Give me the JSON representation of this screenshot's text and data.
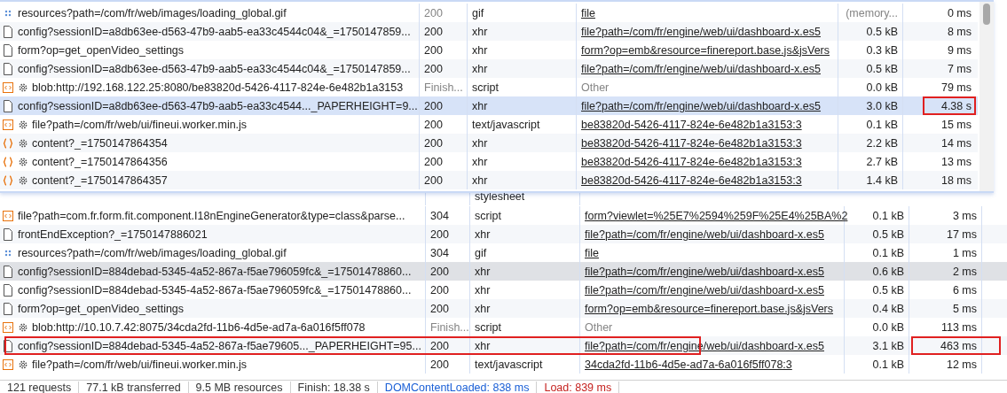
{
  "overlay_table": {
    "rows": [
      {
        "kind": "image",
        "worker": false,
        "name": "resources?path=/com/fr/web/images/loading_global.gif",
        "status": "200",
        "status_dim": true,
        "type": "gif",
        "initiator": "file",
        "initiator_link": true,
        "size": "(memory...",
        "size_dim": true,
        "time": "0 ms",
        "selected": false,
        "highlight_time": false
      },
      {
        "kind": "doc",
        "worker": false,
        "name": "config?sessionID=a8db63ee-d563-47b9-aab5-ea33c4544c04&_=1750147859...",
        "status": "200",
        "status_dim": false,
        "type": "xhr",
        "initiator": "file?path=/com/fr/engine/web/ui/dashboard-x.es5",
        "initiator_link": true,
        "size": "0.5 kB",
        "size_dim": false,
        "time": "8 ms",
        "selected": false,
        "highlight_time": false
      },
      {
        "kind": "doc",
        "worker": false,
        "name": "form?op=get_openVideo_settings",
        "status": "200",
        "status_dim": false,
        "type": "xhr",
        "initiator": "form?op=emb&resource=finereport.base.js&jsVers",
        "initiator_link": true,
        "size": "0.3 kB",
        "size_dim": false,
        "time": "9 ms",
        "selected": false,
        "highlight_time": false
      },
      {
        "kind": "doc",
        "worker": false,
        "name": "config?sessionID=a8db63ee-d563-47b9-aab5-ea33c4544c04&_=1750147859...",
        "status": "200",
        "status_dim": false,
        "type": "xhr",
        "initiator": "file?path=/com/fr/engine/web/ui/dashboard-x.es5",
        "initiator_link": true,
        "size": "0.5 kB",
        "size_dim": false,
        "time": "7 ms",
        "selected": false,
        "highlight_time": false
      },
      {
        "kind": "script",
        "worker": true,
        "name": "blob:http://192.168.122.25:8080/be83820d-5426-4117-824e-6e482b1a3153",
        "status": "Finish...",
        "status_dim": true,
        "type": "script",
        "initiator": "Other",
        "initiator_link": false,
        "size": "0.0 kB",
        "size_dim": false,
        "time": "79 ms",
        "selected": false,
        "highlight_time": false
      },
      {
        "kind": "doc",
        "worker": false,
        "name": "config?sessionID=a8db63ee-d563-47b9-aab5-ea33c4544..._PAPERHEIGHT=9...",
        "status": "200",
        "status_dim": false,
        "type": "xhr",
        "initiator": "file?path=/com/fr/engine/web/ui/dashboard-x.es5",
        "initiator_link": true,
        "size": "3.0 kB",
        "size_dim": false,
        "time": "4.38 s",
        "selected": true,
        "highlight_time": true
      },
      {
        "kind": "script",
        "worker": true,
        "name": "file?path=/com/fr/web/ui/fineui.worker.min.js",
        "status": "200",
        "status_dim": false,
        "type": "text/javascript",
        "initiator": "be83820d-5426-4117-824e-6e482b1a3153:3",
        "initiator_link": true,
        "size": "0.1 kB",
        "size_dim": false,
        "time": "15 ms",
        "selected": false,
        "highlight_time": false
      },
      {
        "kind": "fetch",
        "worker": true,
        "name": "content?_=1750147864354",
        "status": "200",
        "status_dim": false,
        "type": "xhr",
        "initiator": "be83820d-5426-4117-824e-6e482b1a3153:3",
        "initiator_link": true,
        "size": "2.2 kB",
        "size_dim": false,
        "time": "14 ms",
        "selected": false,
        "highlight_time": false
      },
      {
        "kind": "fetch",
        "worker": true,
        "name": "content?_=1750147864356",
        "status": "200",
        "status_dim": false,
        "type": "xhr",
        "initiator": "be83820d-5426-4117-824e-6e482b1a3153:3",
        "initiator_link": true,
        "size": "2.7 kB",
        "size_dim": false,
        "time": "13 ms",
        "selected": false,
        "highlight_time": false
      },
      {
        "kind": "fetch",
        "worker": true,
        "name": "content?_=1750147864357",
        "status": "200",
        "status_dim": false,
        "type": "xhr",
        "initiator": "be83820d-5426-4117-824e-6e482b1a3153:3",
        "initiator_link": true,
        "size": "1.4 kB",
        "size_dim": false,
        "time": "18 ms",
        "selected": false,
        "highlight_time": false
      }
    ]
  },
  "table": {
    "covered_row_type": "stylesheet",
    "rows": [
      {
        "kind": "script",
        "worker": false,
        "name": "file?path=com.fr.form.fit.component.I18nEngineGenerator&type=class&parse...",
        "status": "304",
        "status_dim": false,
        "type": "script",
        "initiator": "form?viewlet=%25E7%2594%259F%25E4%25BA%2",
        "initiator_link": true,
        "size": "0.1 kB",
        "time": "3 ms",
        "hovered": false,
        "highlight_name": false,
        "highlight_time": false
      },
      {
        "kind": "doc",
        "worker": false,
        "name": "frontEndException?_=1750147886021",
        "status": "200",
        "status_dim": false,
        "type": "xhr",
        "initiator": "file?path=/com/fr/engine/web/ui/dashboard-x.es5",
        "initiator_link": true,
        "size": "0.5 kB",
        "time": "17 ms",
        "hovered": false,
        "highlight_name": false,
        "highlight_time": false
      },
      {
        "kind": "image",
        "worker": false,
        "name": "resources?path=/com/fr/web/images/loading_global.gif",
        "status": "304",
        "status_dim": false,
        "type": "gif",
        "initiator": "file",
        "initiator_link": true,
        "size": "0.1 kB",
        "time": "1 ms",
        "hovered": false,
        "highlight_name": false,
        "highlight_time": false
      },
      {
        "kind": "doc",
        "worker": false,
        "name": "config?sessionID=884debad-5345-4a52-867a-f5ae796059fc&_=17501478860...",
        "status": "200",
        "status_dim": false,
        "type": "xhr",
        "initiator": "file?path=/com/fr/engine/web/ui/dashboard-x.es5",
        "initiator_link": true,
        "size": "0.6 kB",
        "time": "2 ms",
        "hovered": true,
        "highlight_name": false,
        "highlight_time": false
      },
      {
        "kind": "doc",
        "worker": false,
        "name": "config?sessionID=884debad-5345-4a52-867a-f5ae796059fc&_=17501478860...",
        "status": "200",
        "status_dim": false,
        "type": "xhr",
        "initiator": "file?path=/com/fr/engine/web/ui/dashboard-x.es5",
        "initiator_link": true,
        "size": "0.5 kB",
        "time": "6 ms",
        "hovered": false,
        "highlight_name": false,
        "highlight_time": false
      },
      {
        "kind": "doc",
        "worker": false,
        "name": "form?op=get_openVideo_settings",
        "status": "200",
        "status_dim": false,
        "type": "xhr",
        "initiator": "form?op=emb&resource=finereport.base.js&jsVers",
        "initiator_link": true,
        "size": "0.4 kB",
        "time": "5 ms",
        "hovered": false,
        "highlight_name": false,
        "highlight_time": false
      },
      {
        "kind": "script",
        "worker": true,
        "name": "blob:http://10.10.7.42:8075/34cda2fd-11b6-4d5e-ad7a-6a016f5ff078",
        "status": "Finish...",
        "status_dim": true,
        "type": "script",
        "initiator": "Other",
        "initiator_link": false,
        "size": "0.0 kB",
        "time": "113 ms",
        "hovered": false,
        "highlight_name": false,
        "highlight_time": false
      },
      {
        "kind": "doc",
        "worker": false,
        "name": "config?sessionID=884debad-5345-4a52-867a-f5ae79605..._PAPERHEIGHT=95...",
        "status": "200",
        "status_dim": false,
        "type": "xhr",
        "initiator": "file?path=/com/fr/engine/web/ui/dashboard-x.es5",
        "initiator_link": true,
        "size": "3.1 kB",
        "time": "463 ms",
        "hovered": false,
        "highlight_name": true,
        "highlight_time": true
      },
      {
        "kind": "script",
        "worker": true,
        "name": "file?path=/com/fr/web/ui/fineui.worker.min.js",
        "status": "200",
        "status_dim": false,
        "type": "text/javascript",
        "initiator": "34cda2fd-11b6-4d5e-ad7a-6a016f5ff078:3",
        "initiator_link": true,
        "size": "0.1 kB",
        "time": "12 ms",
        "hovered": false,
        "highlight_name": false,
        "highlight_time": false
      }
    ]
  },
  "status_bar": [
    {
      "text": "121 requests",
      "color": "#333333"
    },
    {
      "text": "77.1 kB transferred",
      "color": "#333333"
    },
    {
      "text": "9.5 MB resources",
      "color": "#333333"
    },
    {
      "text": "Finish: 18.38 s",
      "color": "#333333"
    },
    {
      "text": "DOMContentLoaded: 838 ms",
      "color": "#1a5fd6"
    },
    {
      "text": "Load: 839 ms",
      "color": "#c5221f"
    }
  ]
}
